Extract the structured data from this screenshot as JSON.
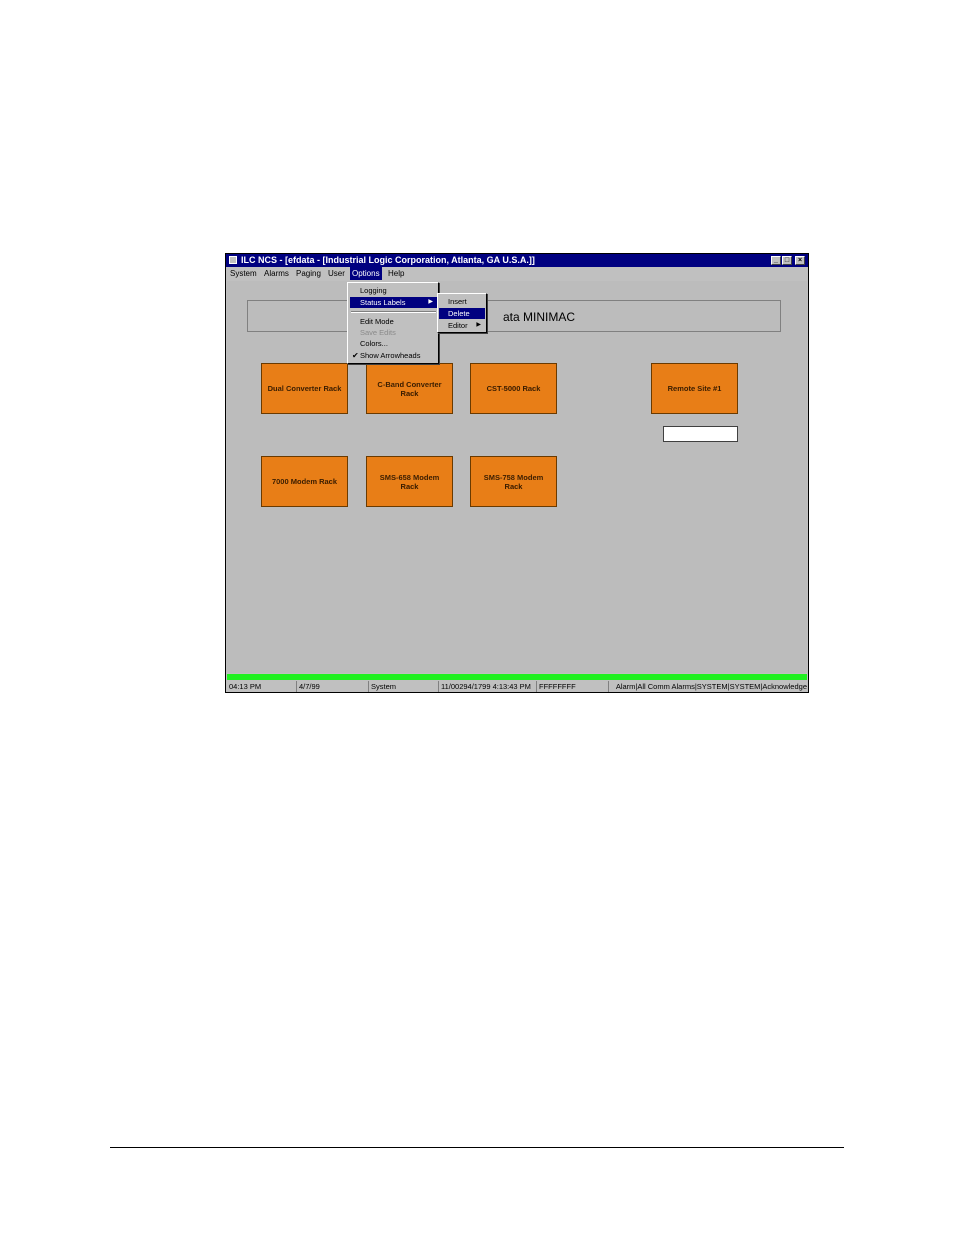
{
  "window": {
    "title": "ILC NCS - [efdata - [Industrial Logic Corporation, Atlanta, GA U.S.A.]]",
    "buttons": {
      "minimize": "_",
      "maximize": "□",
      "close": "×"
    }
  },
  "menubar": {
    "items": [
      "System",
      "Alarms",
      "Paging",
      "User",
      "Options",
      "Help"
    ],
    "active": "Options"
  },
  "options_menu": {
    "items": [
      {
        "label": "Logging"
      },
      {
        "label": "Status Labels"
      },
      {
        "label": "Edit Mode"
      },
      {
        "label": "Save Edits"
      },
      {
        "label": "Colors..."
      },
      {
        "label": "Show Arrowheads"
      }
    ],
    "arrow": "▶",
    "check": "✔"
  },
  "status_labels_submenu": {
    "items": [
      "Insert",
      "Delete",
      "Editor"
    ]
  },
  "banner": {
    "text": "ata MINIMAC"
  },
  "racks": [
    "Dual Converter Rack",
    "C-Band Converter Rack",
    "CST-5000 Rack",
    "Remote Site #1",
    "7000 Modem Rack",
    "SMS-658 Modem Rack",
    "SMS-758 Modem Rack"
  ],
  "statusbar": {
    "time": "04:13 PM",
    "date": "4/7/99",
    "user": "System",
    "event_time": "11/00294/1799 4:13:43 PM",
    "code": "FFFFFFFF",
    "message": "Alarm|All Comm Alarms|SYSTEM|SYSTEM|Acknowledge"
  },
  "colors": {
    "titlebar": "#000080",
    "rack_fill": "#f58a1f",
    "status_green": "#20f020",
    "canvas": "#c8c8c8"
  }
}
